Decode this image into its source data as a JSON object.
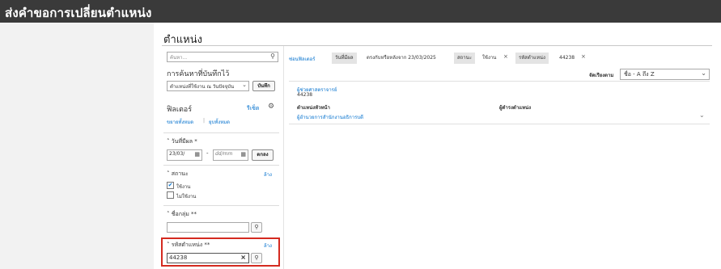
{
  "app": {
    "title": "ส่งคำขอการเปลี่ยนตำแหน่ง"
  },
  "page": {
    "title": "ตำแหน่ง"
  },
  "search": {
    "placeholder": "ค้นหา..."
  },
  "saved_search": {
    "heading": "การค้นหาที่บันทึกไว้",
    "selected": "ตำแหน่งที่ใช้งาน ณ วันปัจจุบัน",
    "save_label": "บันทึก"
  },
  "filters": {
    "heading": "ฟิลเตอร์",
    "reset_label": "รีเซ็ต",
    "expand_all": "ขยายทั้งหมด",
    "separator": "|",
    "collapse_all": "ยุบทั้งหมด",
    "effective_date": {
      "label": "วันที่มีผล *",
      "from_value": "23/03/",
      "to_placeholder": "dd/mm",
      "dash": "-",
      "ok_label": "ตกลง"
    },
    "status": {
      "label": "สถานะ",
      "clear_label": "ล้าง",
      "options": [
        {
          "label": "ใช้งาน",
          "checked": true
        },
        {
          "label": "ไม่ใช้งาน",
          "checked": false
        }
      ]
    },
    "group_name": {
      "label": "ชื่อกลุ่ม **",
      "value": ""
    },
    "position_code": {
      "label": "รหัสตำแหน่ง **",
      "clear_label": "ล้าง",
      "value": "44238"
    }
  },
  "chips": {
    "hide_filters": "ซ่อนฟิลเตอร์",
    "items": [
      {
        "key": "วันที่มีผล",
        "value": "ตรงกับหรือหลังจาก 23/03/2025",
        "removable": false
      },
      {
        "key": "สถานะ",
        "value": "ใช้งาน",
        "removable": true
      },
      {
        "key": "รหัสตำแหน่ง",
        "value": "44238",
        "removable": true
      }
    ]
  },
  "sort": {
    "label": "จัดเรียงตาม",
    "selected": "ชื่อ - A ถึง Z"
  },
  "results": [
    {
      "title": "ผู้ช่วยศาสตราจารย์",
      "code": "44238",
      "col1_header": "ตำแหน่งหัวหน้า",
      "col1_value": "ผู้อำนวยการสำนักงานอธิการบดี",
      "col2_header": "ผู้ดำรงตำแหน่ง",
      "col2_value": ""
    }
  ],
  "colors": {
    "topbar": "#3a3a3a",
    "link": "#0572ce",
    "highlight": "#d42a20",
    "left_panel": "#f2f2f2"
  }
}
